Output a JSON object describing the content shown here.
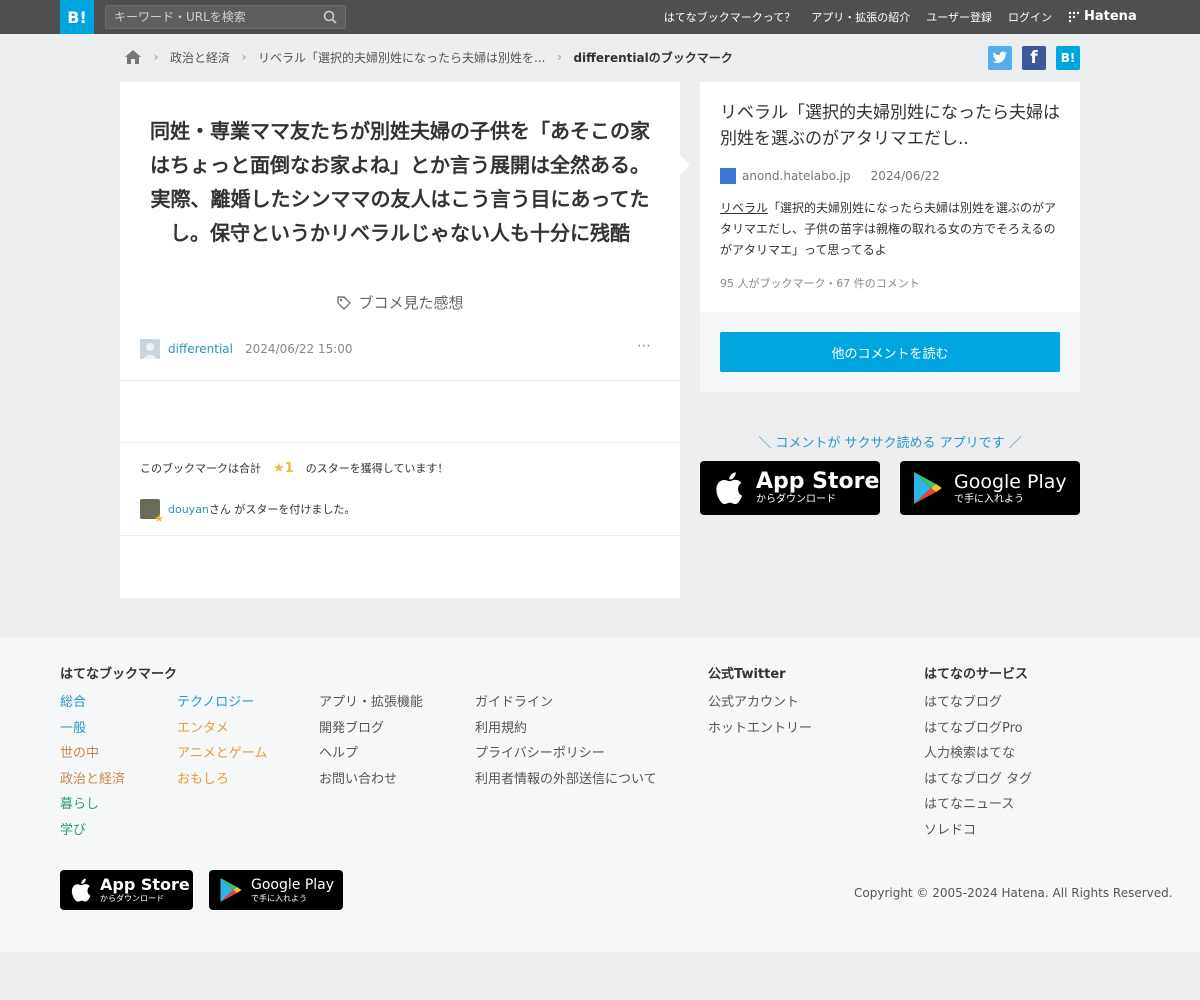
{
  "header": {
    "logo": "B!",
    "search_placeholder": "キーワード・URLを検索",
    "nav": [
      "はてなブックマークって？",
      "アプリ・拡張の紹介",
      "ユーザー登録",
      "ログイン"
    ],
    "brand": "Hatena"
  },
  "breadcrumb": {
    "items": [
      "政治と経済",
      "リベラル「選択的夫婦別姓になったら夫婦は別姓を...",
      "differentialのブックマーク"
    ]
  },
  "share": {
    "twitter": "t",
    "facebook": "f",
    "hatena": "B!"
  },
  "bookmark": {
    "comment": "同姓・専業ママ友たちが別姓夫婦の子供を「あそこの家はちょっと面倒なお家よね」とか言う展開は全然ある。実際、離婚したシンママの友人はこう言う目にあってたし。保守というかリベラルじゃない人も十分に残酷",
    "tag": "ブコメ見た感想",
    "user": "differential",
    "timestamp": "2024/06/22 15:00",
    "more": "⋯"
  },
  "stars": {
    "summary_prefix": "このブックマークは合計",
    "count": "★1",
    "summary_suffix": "のスターを獲得しています！",
    "giver": "douyan",
    "giver_suffix": "さん がスターを付けました。"
  },
  "entry": {
    "title": "リベラル「選択的夫婦別姓になったら夫婦は別姓を選ぶのがアタリマエだし..",
    "domain": "anond.hatelabo.jp",
    "date": "2024/06/22",
    "summary_tag": "リベラル",
    "summary_rest": "「選択的夫婦別姓になったら夫婦は別姓を選ぶのがアタリマエだし、子供の苗字は親権の取れる女の方でそろえるのがアタリマエ」って思ってるよ",
    "counts": "95 人がブックマーク・67 件のコメント",
    "read_button": "他のコメントを読む"
  },
  "promo": {
    "text": "＼ コメントが サクサク読める アプリです ／",
    "appstore_main": "App Store",
    "appstore_sub": "からダウンロード",
    "googleplay_main": "Google Play",
    "googleplay_sub": "で手に入れよう"
  },
  "footer": {
    "col1_title": "はてなブックマーク",
    "categories_left": [
      "総合",
      "一般",
      "世の中",
      "政治と経済",
      "暮らし",
      "学び"
    ],
    "categories_right": [
      "テクノロジー",
      "エンタメ",
      "アニメとゲーム",
      "おもしろ"
    ],
    "links_a": [
      "アプリ・拡張機能",
      "開発ブログ",
      "ヘルプ",
      "お問い合わせ"
    ],
    "links_b": [
      "ガイドライン",
      "利用規約",
      "プライバシーポリシー",
      "利用者情報の外部送信について"
    ],
    "twitter_title": "公式Twitter",
    "twitter_links": [
      "公式アカウント",
      "ホットエントリー"
    ],
    "services_title": "はてなのサービス",
    "services_links": [
      "はてなブログ",
      "はてなブログPro",
      "人力検索はてな",
      "はてなブログ タグ",
      "はてなニュース",
      "ソレドコ"
    ],
    "copyright": "Copyright © 2005-2024 Hatena. All Rights Reserved."
  },
  "colors": {
    "accent": "#00a4de",
    "link": "#2696c4",
    "star": "#f1b736",
    "header_bg": "#4f4f4f"
  }
}
